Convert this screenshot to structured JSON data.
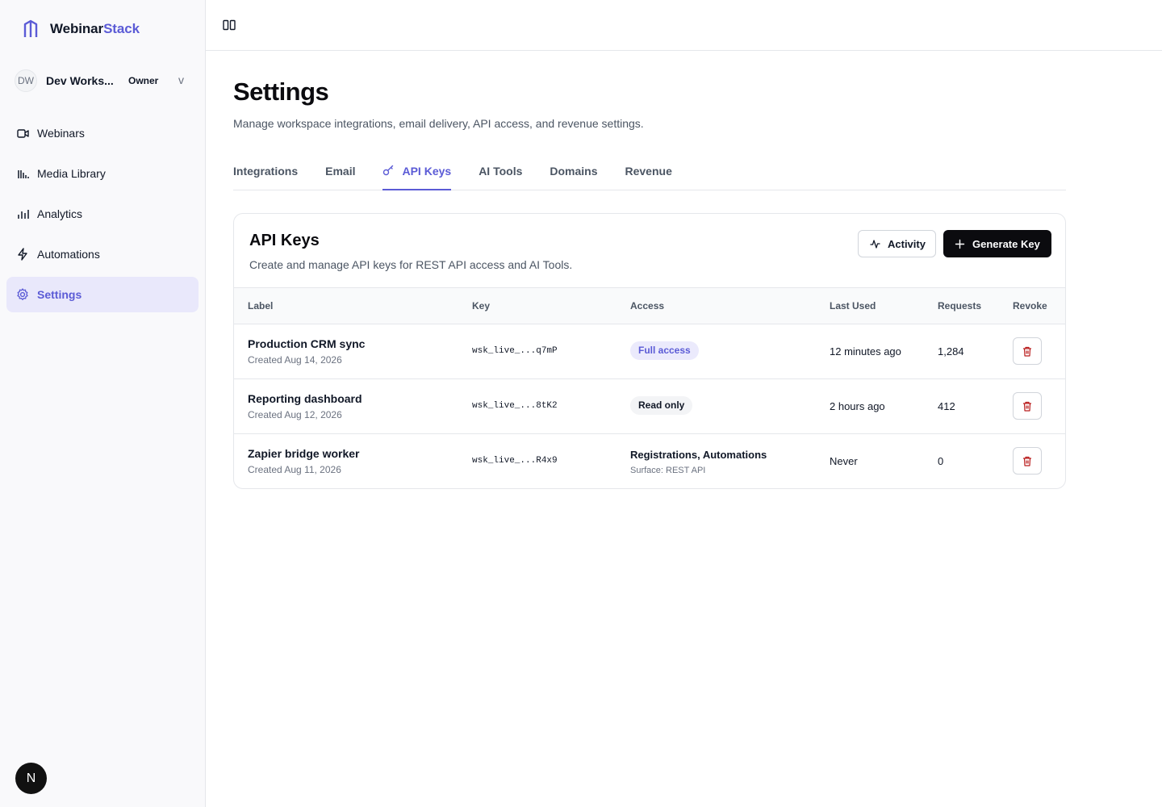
{
  "brand": {
    "name_part1": "Webinar",
    "name_part2": "Stack",
    "accent_color": "#5b5bd6"
  },
  "workspace": {
    "initials": "DW",
    "name": "Dev Works...",
    "role": "Owner",
    "caret": "v"
  },
  "sidebar": {
    "items": [
      {
        "label": "Webinars",
        "icon": "video-icon"
      },
      {
        "label": "Media Library",
        "icon": "media-library-icon"
      },
      {
        "label": "Analytics",
        "icon": "bar-chart-icon"
      },
      {
        "label": "Automations",
        "icon": "lightning-icon"
      },
      {
        "label": "Settings",
        "icon": "gear-icon",
        "active": true
      }
    ]
  },
  "user": {
    "initial": "N"
  },
  "page": {
    "title": "Settings",
    "subtitle": "Manage workspace integrations, email delivery, API access, and revenue settings."
  },
  "tabs": [
    {
      "label": "Integrations"
    },
    {
      "label": "Email"
    },
    {
      "label": "API Keys",
      "active": true,
      "icon": "key-icon"
    },
    {
      "label": "AI Tools"
    },
    {
      "label": "Domains"
    },
    {
      "label": "Revenue"
    }
  ],
  "card": {
    "title": "API Keys",
    "description": "Create and manage API keys for REST API access and AI Tools.",
    "activity_label": "Activity",
    "generate_label": "Generate Key"
  },
  "table": {
    "headers": [
      "Label",
      "Key",
      "Access",
      "Last Used",
      "Requests",
      "Revoke"
    ],
    "rows": [
      {
        "label": "Production CRM sync",
        "created": "Created Aug 14, 2026",
        "key": "wsk_live_...q7mP",
        "access": "Full access",
        "access_type": "badge-full",
        "access_sub": "",
        "last_used": "12 minutes ago",
        "requests": "1,284"
      },
      {
        "label": "Reporting dashboard",
        "created": "Created Aug 12, 2026",
        "key": "wsk_live_...8tK2",
        "access": "Read only",
        "access_type": "badge-read",
        "access_sub": "",
        "last_used": "2 hours ago",
        "requests": "412"
      },
      {
        "label": "Zapier bridge worker",
        "created": "Created Aug 11, 2026",
        "key": "wsk_live_...R4x9",
        "access": "Registrations, Automations",
        "access_type": "text",
        "access_sub": "Surface: REST API",
        "last_used": "Never",
        "requests": "0"
      }
    ]
  }
}
